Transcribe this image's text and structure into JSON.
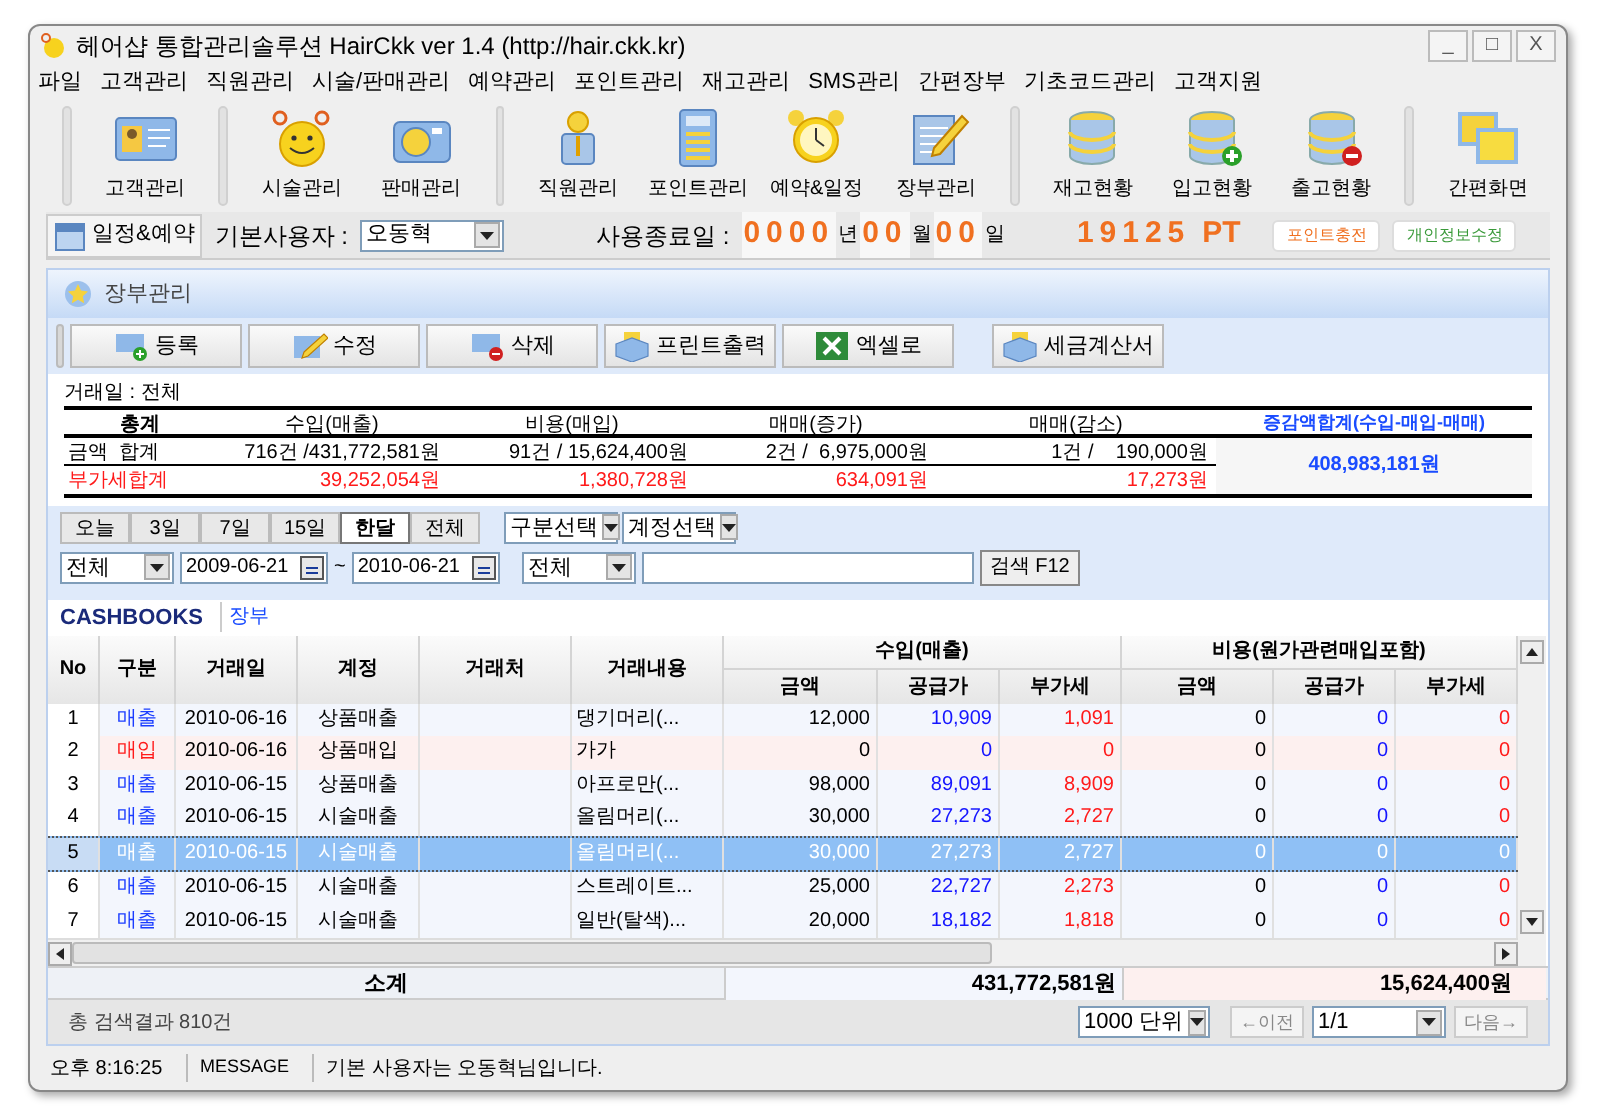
{
  "window": {
    "title": "헤어샵 통합관리솔루션 HairCkk ver 1.4 (http://hair.ckk.kr)",
    "controls": [
      "_",
      "□",
      "X"
    ]
  },
  "menu": [
    "파일",
    "고객관리",
    "직원관리",
    "시술/판매관리",
    "예약관리",
    "포인트관리",
    "재고관리",
    "SMS관리",
    "간편장부",
    "기초코드관리",
    "고객지원"
  ],
  "toolbar": {
    "groups": [
      [
        "고객관리"
      ],
      [
        "시술관리",
        "판매관리"
      ],
      [
        "직원관리",
        "포인트관리",
        "예약&일정",
        "장부관리"
      ],
      [
        "재고현황",
        "입고현황",
        "출고현황"
      ],
      [
        "간편화면"
      ]
    ]
  },
  "infobar": {
    "schedule_button": "일정&예약",
    "user_label": "기본사용자 :",
    "user_select": "오동혁",
    "end_label": "사용종료일 :",
    "end_date": [
      {
        "kind": "digits",
        "text": "0000"
      },
      {
        "kind": "unit",
        "text": "년"
      },
      {
        "kind": "digits",
        "text": "00"
      },
      {
        "kind": "unit",
        "text": "월"
      },
      {
        "kind": "digits",
        "text": "00"
      },
      {
        "kind": "unit",
        "text": "일"
      }
    ],
    "points": "19125",
    "points_unit": "PT",
    "charge_button": "포인트충전",
    "profile_button": "개인정보수정"
  },
  "section_title": "장부관리",
  "actions": [
    "등록",
    "수정",
    "삭제",
    "프린트출력",
    "엑셀로",
    "세금계산서"
  ],
  "summary": {
    "date_label": "거래일 : 전체",
    "headers": [
      "총계",
      "수입(매출)",
      "비용(매입)",
      "매매(증가)",
      "매매(감소)"
    ],
    "net_header": "증감액합계(수입-매입-매매)",
    "net_value": "408,983,181원",
    "rows": [
      {
        "kind": "amount",
        "label": "금액  합계",
        "values": [
          "716건 /431,772,581원",
          "91건 / 15,624,400원",
          "2건 /  6,975,000원",
          "1건 /    190,000원"
        ]
      },
      {
        "kind": "vat",
        "label": "부가세합계",
        "values": [
          "39,252,054원",
          "1,380,728원",
          "634,091원",
          "17,273원"
        ]
      }
    ]
  },
  "filters": {
    "periods": [
      {
        "label": "오늘",
        "selected": false
      },
      {
        "label": "3일",
        "selected": false
      },
      {
        "label": "7일",
        "selected": false
      },
      {
        "label": "15일",
        "selected": false
      },
      {
        "label": "한달",
        "selected": true
      },
      {
        "label": "전체",
        "selected": false
      }
    ],
    "category_select": "구분선택",
    "account_select": "계정선택",
    "date_type_select": "전체",
    "date_from": "2009-06-21",
    "date_sep": "~",
    "date_to": "2010-06-21",
    "field_select": "전체",
    "search_button": "검색 F12"
  },
  "cashbooks": {
    "title": "CASHBOOKS",
    "subtitle": "장부"
  },
  "table": {
    "columns": [
      "No",
      "구분",
      "거래일",
      "계정",
      "거래처",
      "거래내용"
    ],
    "income_header": "수입(매출)",
    "expense_header": "비용(원가관련매입포함)",
    "income_sub_columns": [
      {
        "kind": "amount",
        "label": "금액"
      },
      {
        "kind": "supply",
        "label": "공급가"
      },
      {
        "kind": "vat",
        "label": "부가세"
      }
    ],
    "expense_sub_columns": [
      {
        "kind": "amount",
        "label": "금액"
      },
      {
        "kind": "supply",
        "label": "공급가"
      },
      {
        "kind": "vat",
        "label": "부가세"
      }
    ],
    "rows": [
      {
        "no": "1",
        "kind": "sale",
        "category": "매출",
        "date": "2010-06-16",
        "account": "상품매출",
        "description": "댕기머리(...",
        "income": [
          "12,000",
          "10,909",
          "1,091"
        ],
        "expense": [
          "0",
          "0",
          "0"
        ],
        "selected": false
      },
      {
        "no": "2",
        "kind": "purchase",
        "category": "매입",
        "date": "2010-06-16",
        "account": "상품매입",
        "description": "가가",
        "income": [
          "0",
          "0",
          "0"
        ],
        "expense": [
          "0",
          "0",
          "0"
        ],
        "selected": false
      },
      {
        "no": "3",
        "kind": "sale",
        "category": "매출",
        "date": "2010-06-15",
        "account": "상품매출",
        "description": "아프로만(...",
        "income": [
          "98,000",
          "89,091",
          "8,909"
        ],
        "expense": [
          "0",
          "0",
          "0"
        ],
        "selected": false
      },
      {
        "no": "4",
        "kind": "sale",
        "category": "매출",
        "date": "2010-06-15",
        "account": "시술매출",
        "description": "올림머리(...",
        "income": [
          "30,000",
          "27,273",
          "2,727"
        ],
        "expense": [
          "0",
          "0",
          "0"
        ],
        "selected": false
      },
      {
        "no": "5",
        "kind": "sale",
        "category": "매출",
        "date": "2010-06-15",
        "account": "시술매출",
        "description": "올림머리(...",
        "income": [
          "30,000",
          "27,273",
          "2,727"
        ],
        "expense": [
          "0",
          "0",
          "0"
        ],
        "selected": true
      },
      {
        "no": "6",
        "kind": "sale",
        "category": "매출",
        "date": "2010-06-15",
        "account": "시술매출",
        "description": "스트레이트...",
        "income": [
          "25,000",
          "22,727",
          "2,273"
        ],
        "expense": [
          "0",
          "0",
          "0"
        ],
        "selected": false
      },
      {
        "no": "7",
        "kind": "sale",
        "category": "매출",
        "date": "2010-06-15",
        "account": "시술매출",
        "description": "일반(탈색)...",
        "income": [
          "20,000",
          "18,182",
          "1,818"
        ],
        "expense": [
          "0",
          "0",
          "0"
        ],
        "selected": false
      }
    ],
    "subtotal": {
      "label": "소계",
      "income": "431,772,581원",
      "expense": "15,624,400원"
    }
  },
  "footer": {
    "result": "총 검색결과 810건",
    "unit_select": "1000 단위",
    "prev_button": "←이전",
    "page_select": "1/1",
    "next_button": "다음→"
  },
  "status_bar": {
    "time": "오후 8:16:25",
    "message_label": "MESSAGE",
    "message": "기본 사용자는 오동혁님입니다."
  }
}
